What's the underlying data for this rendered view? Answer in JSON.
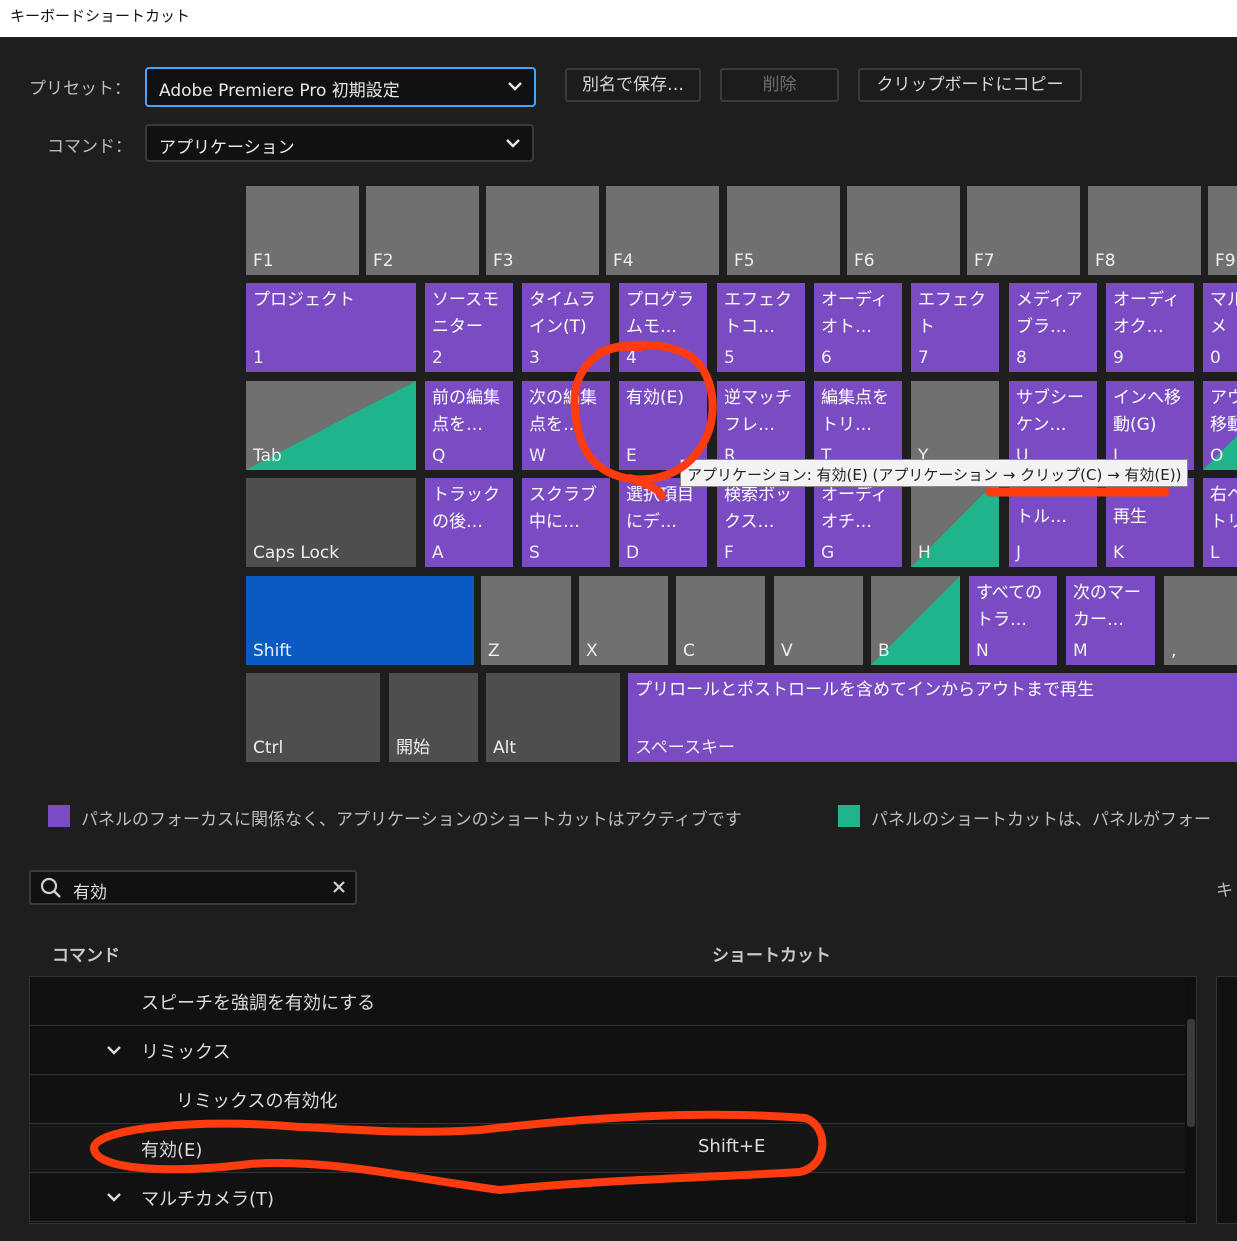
{
  "window": {
    "title": "キーボードショートカット"
  },
  "preset": {
    "label": "プリセット：",
    "value": "Adobe Premiere Pro 初期設定"
  },
  "command_select": {
    "label": "コマンド：",
    "value": "アプリケーション"
  },
  "buttons": {
    "save_as": "別名で保存…",
    "delete": "削除",
    "copy_clipboard": "クリップボードにコピー"
  },
  "keys": {
    "f1": "F1",
    "f2": "F2",
    "f3": "F3",
    "f4": "F4",
    "f5": "F5",
    "f6": "F6",
    "f7": "F7",
    "f8": "F8",
    "f9": "F9",
    "k1": {
      "cmd": "プロジェクト",
      "label": "1"
    },
    "k2": {
      "cmd": "ソースモニター",
      "label": "2"
    },
    "k3": {
      "cmd": "タイムライン(T)",
      "label": "3"
    },
    "k4": {
      "cmd": "プログラムモ…",
      "label": "4"
    },
    "k5": {
      "cmd": "エフェクトコ…",
      "label": "5"
    },
    "k6": {
      "cmd": "オーディオト…",
      "label": "6"
    },
    "k7": {
      "cmd": "エフェクト",
      "label": "7"
    },
    "k8": {
      "cmd": "メディアブラ…",
      "label": "8"
    },
    "k9": {
      "cmd": "オーディオク…",
      "label": "9"
    },
    "k0": {
      "cmd": "マルメ",
      "label": "0"
    },
    "tab": {
      "label": "Tab"
    },
    "q": {
      "cmd": "前の編集点を…",
      "label": "Q"
    },
    "w": {
      "cmd": "次の編集点を…",
      "label": "W"
    },
    "e": {
      "cmd": "有効(E)",
      "label": "E"
    },
    "r": {
      "cmd": "逆マッチフレ…",
      "label": "R"
    },
    "t": {
      "cmd": "編集点をトリ…",
      "label": "T"
    },
    "y": {
      "label": "Y"
    },
    "u": {
      "cmd": "サブシーケン…",
      "label": "U"
    },
    "i": {
      "cmd": "インへ移動(G)",
      "label": "I"
    },
    "o": {
      "cmd": "アウ移動",
      "label": "O"
    },
    "caps": {
      "label": "Caps Lock"
    },
    "a": {
      "cmd": "トラックの後…",
      "label": "A"
    },
    "s": {
      "cmd": "スクラブ中に…",
      "label": "S"
    },
    "d": {
      "cmd": "選択項目にデ…",
      "label": "D"
    },
    "f": {
      "cmd": "検索ボックス…",
      "label": "F"
    },
    "g": {
      "cmd": "オーディオチ…",
      "label": "G"
    },
    "h": {
      "label": "H"
    },
    "j": {
      "cmd": "トル…",
      "label": "J"
    },
    "k": {
      "cmd": "再生",
      "label": "K"
    },
    "l": {
      "cmd": "右へトリ",
      "label": "L"
    },
    "shift": {
      "label": "Shift"
    },
    "z": {
      "label": "Z"
    },
    "x": {
      "label": "X"
    },
    "c": {
      "label": "C"
    },
    "v": {
      "label": "V"
    },
    "b": {
      "label": "B"
    },
    "n": {
      "cmd": "すべてのトラ…",
      "label": "N"
    },
    "m": {
      "cmd": "次のマーカー…",
      "label": "M"
    },
    "comma": {
      "label": ","
    },
    "ctrl": {
      "label": "Ctrl"
    },
    "start": {
      "label": "開始"
    },
    "alt": {
      "label": "Alt"
    },
    "space": {
      "cmd": "プリロールとポストロールを含めてインからアウトまで再生",
      "label": "スペースキー"
    }
  },
  "tooltip": "アプリケーション: 有効(E) (アプリケーション → クリップ(C) → 有効(E))",
  "legend": {
    "app_text": "パネルのフォーカスに関係なく、アプリケーションのショートカットはアクティブです",
    "panel_text": "パネルのショートカットは、パネルがフォー",
    "app_color": "#7a4bc2",
    "panel_color": "#1fb48a"
  },
  "search": {
    "value": "有効",
    "right_label": "キ"
  },
  "table": {
    "headers": {
      "command": "コマンド",
      "shortcut": "ショートカット"
    },
    "rows": [
      {
        "label": "スピーチを強調を有効にする",
        "shortcut": ""
      },
      {
        "label": "リミックス",
        "shortcut": ""
      },
      {
        "label": "リミックスの有効化",
        "shortcut": ""
      },
      {
        "label": "有効(E)",
        "shortcut": "Shift+E"
      },
      {
        "label": "マルチカメラ(T)",
        "shortcut": ""
      }
    ]
  },
  "colors": {
    "accent": "#4aa3ff",
    "annotation": "#ff3b0f"
  }
}
